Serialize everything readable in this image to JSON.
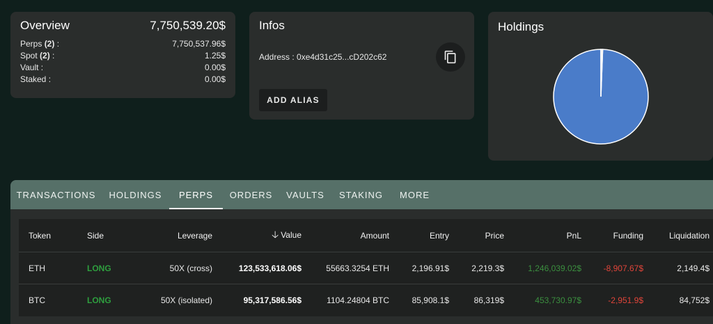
{
  "overview": {
    "title": "Overview",
    "total": "7,750,539.20$",
    "rows": [
      {
        "label_pre": "Perps ",
        "label_count": "(2)",
        "label_post": " :",
        "value": "7,750,537.96$"
      },
      {
        "label_pre": "Spot ",
        "label_count": "(2)",
        "label_post": " :",
        "value": "1.25$"
      },
      {
        "label_pre": "Vault :",
        "label_count": "",
        "label_post": "",
        "value": "0.00$"
      },
      {
        "label_pre": "Staked :",
        "label_count": "",
        "label_post": "",
        "value": "0.00$"
      }
    ]
  },
  "infos": {
    "title": "Infos",
    "address": "Address : 0xe4d31c25...cD202c62",
    "add_alias": "ADD ALIAS",
    "copy_icon": "copy-icon"
  },
  "holdings": {
    "title": "Holdings",
    "colors": {
      "main": "#4a7cc9",
      "minor": "#e8e8e8",
      "stroke": "#ffffff"
    }
  },
  "chart_data": {
    "type": "pie",
    "title": "Holdings",
    "categories": [
      "Perps",
      "Spot"
    ],
    "values": [
      7750537.96,
      1.25
    ]
  },
  "tabs": [
    {
      "label": "TRANSACTIONS",
      "active": false
    },
    {
      "label": "HOLDINGS",
      "active": false
    },
    {
      "label": "PERPS",
      "active": true
    },
    {
      "label": "ORDERS",
      "active": false
    },
    {
      "label": "VAULTS",
      "active": false
    },
    {
      "label": "STAKING",
      "active": false
    },
    {
      "label": "MORE",
      "active": false
    }
  ],
  "table": {
    "headers": {
      "token": "Token",
      "side": "Side",
      "leverage": "Leverage",
      "value": "Value",
      "amount": "Amount",
      "entry": "Entry",
      "price": "Price",
      "pnl": "PnL",
      "funding": "Funding",
      "liquidation": "Liquidation"
    },
    "sort_icon": "arrow-down-icon",
    "rows": [
      {
        "token": "ETH",
        "side": "LONG",
        "leverage": "50X (cross)",
        "value": "123,533,618.06$",
        "amount": "55663.3254 ETH",
        "entry": "2,196.91$",
        "price": "2,219.3$",
        "pnl": "1,246,039.02$",
        "funding": "-8,907.67$",
        "liquidation": "2,149.4$"
      },
      {
        "token": "BTC",
        "side": "LONG",
        "leverage": "50X (isolated)",
        "value": "95,317,586.56$",
        "amount": "1104.24804 BTC",
        "entry": "85,908.1$",
        "price": "86,319$",
        "pnl": "453,730.97$",
        "funding": "-2,951.9$",
        "liquidation": "84,752$"
      }
    ]
  }
}
